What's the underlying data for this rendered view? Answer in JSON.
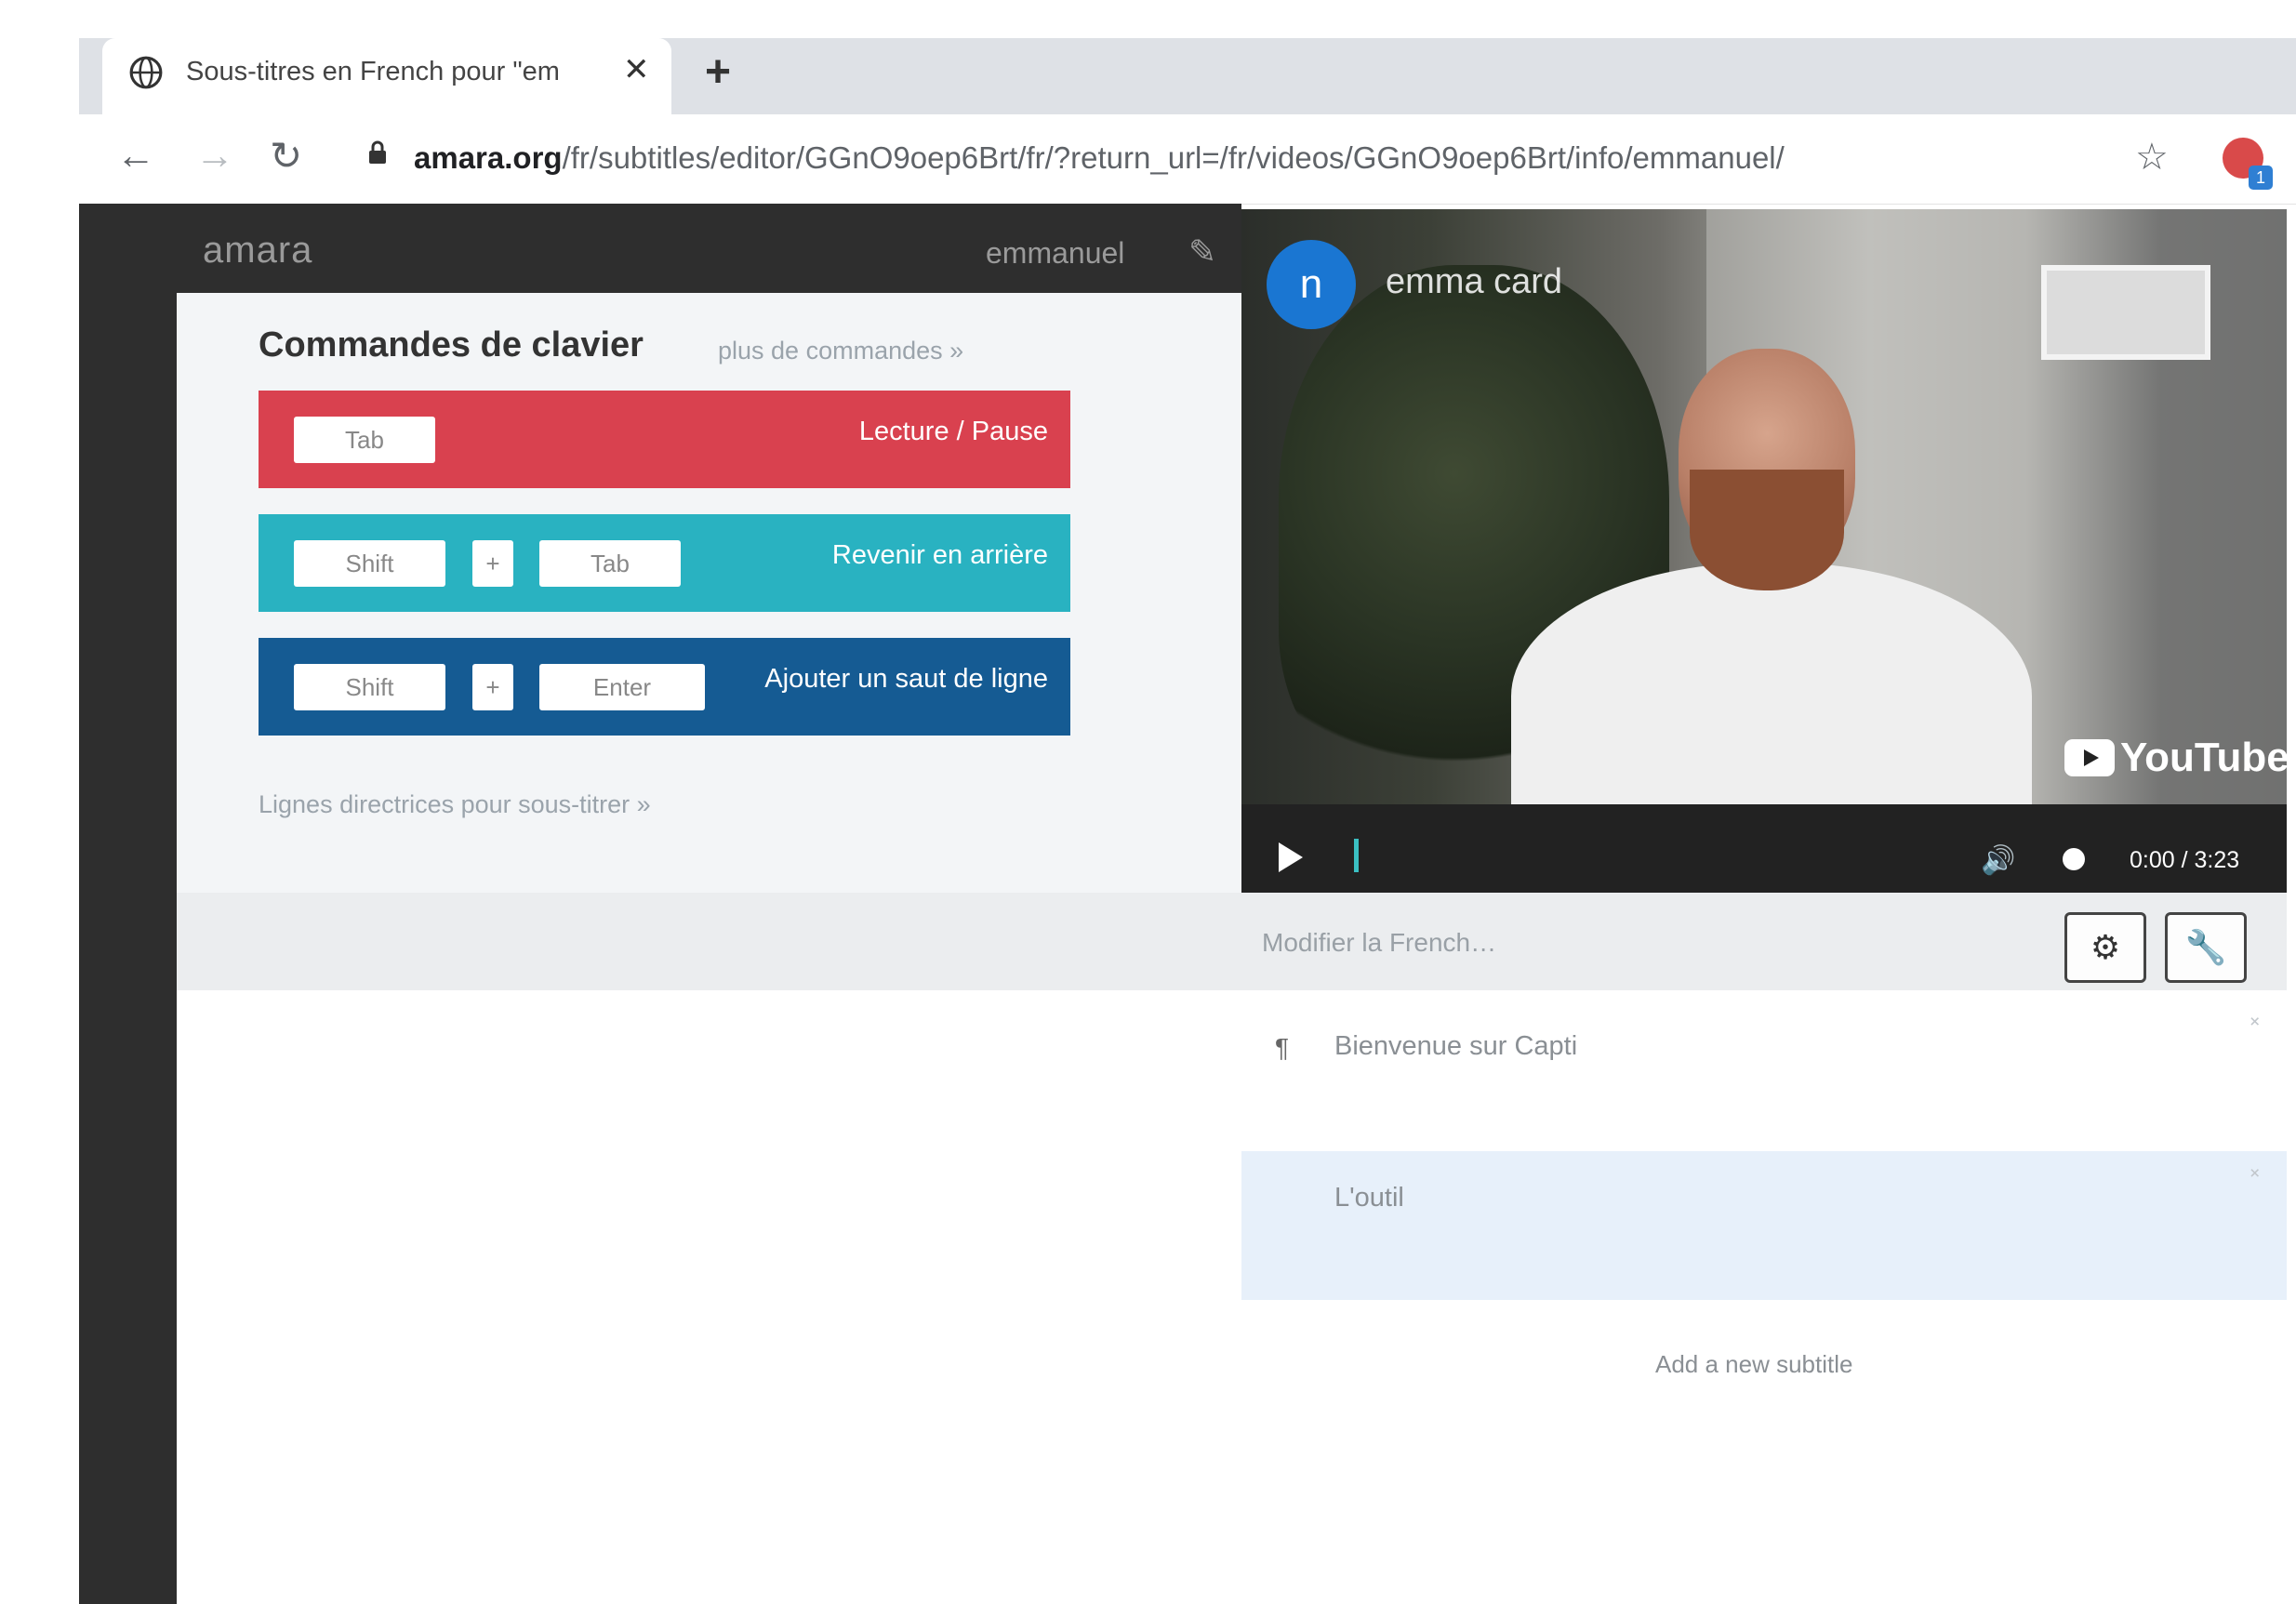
{
  "browser": {
    "tab_title": "Sous-titres en French pour \"em",
    "tab_close": "✕",
    "new_tab": "+",
    "nav": {
      "back": "←",
      "forward": "→",
      "reload": "↻"
    },
    "url_domain": "amara.org",
    "url_path": "/fr/subtitles/editor/GGnO9oep6Brt/fr/?return_url=/fr/videos/GGnO9oep6Brt/info/emmanuel/",
    "star": "☆",
    "ext_badge": "1"
  },
  "app": {
    "logo": "amara",
    "username": "emmanuel",
    "pencil": "✎"
  },
  "help": {
    "title": "Commandes de clavier",
    "more_link": "plus de commandes »",
    "commands": [
      {
        "keys": [
          "Tab"
        ],
        "label": "Lecture / Pause",
        "color": "#d9414f"
      },
      {
        "keys": [
          "Shift",
          "Tab"
        ],
        "plus": "+",
        "label": "Revenir en arrière",
        "color": "#29b2c1"
      },
      {
        "keys": [
          "Shift",
          "Enter"
        ],
        "plus": "+",
        "label": "Ajouter un saut de ligne",
        "color": "#155b93"
      }
    ],
    "guidelines_link": "Lignes directrices pour sous-titrer »"
  },
  "video": {
    "channel_initial": "n",
    "channel_name": "emma card",
    "youtube_label": "YouTube",
    "timecode": "0:00 / 3:23",
    "volume": "🔊"
  },
  "editor": {
    "edit_label": "Modifier la French…",
    "tool_icons": [
      "⚙",
      "🔧"
    ],
    "subtitles": [
      {
        "text": "Bienvenue sur Capti",
        "mark": "¶",
        "highlighted": false
      },
      {
        "text": "L'outil",
        "mark": "",
        "highlighted": true
      }
    ],
    "close_glyph": "˟",
    "add_subtitle": "Add a new subtitle"
  }
}
